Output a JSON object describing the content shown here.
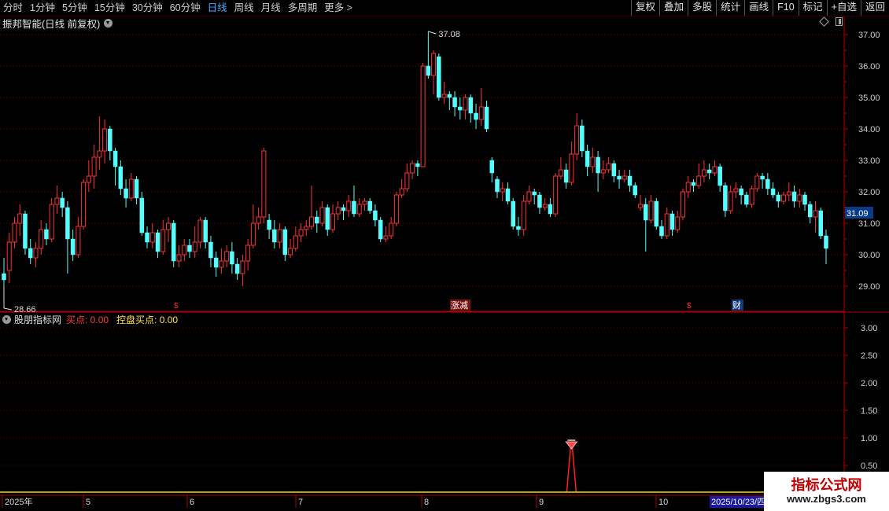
{
  "toolbar": {
    "periods": [
      "分时",
      "1分钟",
      "5分钟",
      "15分钟",
      "30分钟",
      "60分钟",
      "日线",
      "周线",
      "月线",
      "多周期",
      "更多 >"
    ],
    "active_period": "日线",
    "actions": [
      "复权",
      "叠加",
      "多股",
      "统计",
      "画线",
      "F10",
      "标记",
      "+自选",
      "返回"
    ]
  },
  "chart_title": "振邦智能(日线 前复权)",
  "indicator": {
    "name": "股朋指标网",
    "buy_label": "买点: 0.00",
    "control_label": "控盘买点: 0.00"
  },
  "price_axis": {
    "ticks": [
      "37.00",
      "36.00",
      "35.00",
      "34.00",
      "33.00",
      "32.00",
      "31.00",
      "30.00",
      "29.00"
    ]
  },
  "indicator_axis": {
    "ticks": [
      "3.00",
      "2.50",
      "2.00",
      "1.50",
      "1.00",
      "0.50"
    ]
  },
  "current_price": "31.09",
  "high_label": "37.08",
  "low_label": "28.66",
  "markers": {
    "limit_up": "涨减",
    "finance": "财",
    "dollar": "$"
  },
  "time_axis": {
    "labels": [
      "2025年",
      "5",
      "6",
      "7",
      "8",
      "9",
      "10"
    ],
    "selected_date": "2025/10/23/四"
  },
  "watermark": {
    "line1": "指标公式网",
    "line2": "www.zbgs3.com"
  },
  "colors": {
    "up": "#ff3232",
    "down": "#54ffff",
    "grid": "#6b0000",
    "axis": "#b00000",
    "indicator_line": "#ff2020",
    "baseline": "#e8e000"
  },
  "chart_data": {
    "type": "candlestick",
    "title": "振邦智能(日线 前复权)",
    "ylim": [
      28.6,
      37.3
    ],
    "indicator_ylim": [
      0,
      3.25
    ],
    "candles": [
      [
        29.4,
        29.2,
        29.9,
        29.0
      ],
      [
        29.5,
        30.4,
        30.7,
        29.1
      ],
      [
        30.4,
        31.0,
        31.2,
        30.2
      ],
      [
        31.0,
        31.3,
        31.6,
        30.6
      ],
      [
        31.3,
        30.2,
        31.4,
        30.0
      ],
      [
        30.2,
        29.9,
        30.5,
        29.7
      ],
      [
        29.9,
        30.2,
        30.4,
        29.6
      ],
      [
        30.2,
        30.8,
        31.1,
        30.0
      ],
      [
        30.8,
        30.5,
        31.0,
        30.3
      ],
      [
        30.5,
        31.6,
        31.8,
        30.4
      ],
      [
        31.6,
        31.8,
        32.2,
        31.3
      ],
      [
        31.8,
        31.5,
        32.0,
        31.2
      ],
      [
        31.5,
        30.5,
        31.7,
        29.4
      ],
      [
        30.5,
        30.0,
        30.8,
        29.8
      ],
      [
        30.0,
        30.9,
        31.2,
        29.9
      ],
      [
        30.9,
        32.3,
        32.4,
        30.8
      ],
      [
        32.3,
        32.5,
        33.0,
        32.0
      ],
      [
        32.5,
        33.1,
        33.5,
        32.1
      ],
      [
        33.1,
        33.3,
        34.4,
        32.7
      ],
      [
        33.3,
        34.0,
        34.3,
        32.9
      ],
      [
        34.0,
        33.3,
        34.1,
        33.0
      ],
      [
        33.3,
        32.8,
        33.4,
        32.2
      ],
      [
        32.8,
        32.1,
        33.0,
        31.9
      ],
      [
        32.1,
        31.8,
        32.4,
        31.5
      ],
      [
        31.8,
        32.4,
        32.6,
        31.7
      ],
      [
        32.4,
        31.8,
        32.5,
        31.6
      ],
      [
        31.8,
        30.7,
        32.0,
        30.6
      ],
      [
        30.7,
        30.4,
        30.9,
        30.2
      ],
      [
        30.4,
        30.7,
        31.0,
        30.2
      ],
      [
        30.7,
        30.1,
        30.8,
        29.9
      ],
      [
        30.1,
        30.8,
        31.1,
        30.0
      ],
      [
        30.8,
        31.0,
        31.2,
        30.4
      ],
      [
        31.0,
        29.8,
        31.1,
        29.6
      ],
      [
        29.8,
        30.0,
        30.3,
        29.6
      ],
      [
        30.0,
        30.3,
        30.5,
        29.8
      ],
      [
        30.3,
        30.1,
        30.5,
        29.9
      ],
      [
        30.1,
        30.4,
        30.9,
        29.9
      ],
      [
        30.4,
        31.1,
        31.2,
        30.2
      ],
      [
        31.1,
        30.4,
        31.2,
        30.2
      ],
      [
        30.4,
        29.9,
        30.6,
        29.6
      ],
      [
        29.9,
        29.6,
        30.1,
        29.3
      ],
      [
        29.6,
        29.8,
        30.2,
        29.4
      ],
      [
        29.8,
        30.1,
        30.3,
        29.6
      ],
      [
        30.1,
        29.7,
        30.4,
        29.4
      ],
      [
        29.7,
        29.4,
        29.9,
        29.2
      ],
      [
        29.4,
        29.8,
        30.0,
        29.0
      ],
      [
        29.8,
        30.3,
        30.5,
        29.5
      ],
      [
        30.3,
        31.0,
        31.6,
        30.2
      ],
      [
        31.0,
        31.2,
        31.5,
        30.8
      ],
      [
        31.2,
        33.3,
        33.4,
        31.0
      ],
      [
        31.1,
        30.8,
        31.3,
        30.5
      ],
      [
        30.8,
        30.4,
        31.1,
        30.2
      ],
      [
        30.4,
        30.8,
        31.0,
        30.2
      ],
      [
        30.8,
        30.0,
        30.9,
        29.8
      ],
      [
        30.0,
        30.2,
        30.5,
        29.9
      ],
      [
        30.2,
        30.6,
        30.9,
        30.1
      ],
      [
        30.6,
        30.8,
        31.0,
        30.4
      ],
      [
        30.8,
        30.9,
        31.1,
        30.6
      ],
      [
        30.9,
        31.2,
        32.2,
        30.8
      ],
      [
        31.2,
        31.0,
        31.4,
        30.7
      ],
      [
        31.0,
        31.5,
        31.7,
        30.9
      ],
      [
        31.5,
        30.8,
        31.6,
        30.6
      ],
      [
        30.8,
        31.3,
        31.6,
        30.7
      ],
      [
        31.3,
        31.5,
        31.7,
        31.1
      ],
      [
        31.5,
        31.4,
        31.6,
        31.1
      ],
      [
        31.4,
        31.7,
        31.9,
        31.2
      ],
      [
        31.7,
        31.3,
        32.2,
        31.2
      ],
      [
        31.3,
        31.6,
        31.8,
        31.2
      ],
      [
        31.6,
        31.7,
        31.8,
        31.4
      ],
      [
        31.7,
        31.4,
        31.8,
        31.3
      ],
      [
        31.4,
        31.1,
        31.6,
        30.9
      ],
      [
        31.1,
        30.5,
        31.2,
        30.4
      ],
      [
        30.5,
        30.6,
        30.9,
        30.4
      ],
      [
        30.6,
        31.0,
        31.2,
        30.5
      ],
      [
        31.0,
        31.9,
        32.0,
        30.9
      ],
      [
        31.9,
        32.1,
        32.4,
        31.8
      ],
      [
        32.1,
        32.6,
        32.9,
        32.0
      ],
      [
        32.6,
        32.9,
        33.0,
        32.4
      ],
      [
        32.9,
        32.8,
        33.0,
        32.5
      ],
      [
        32.8,
        36.0,
        36.1,
        32.8
      ],
      [
        36.0,
        35.7,
        37.1,
        35.6
      ],
      [
        35.7,
        36.4,
        36.5,
        35.1
      ],
      [
        36.3,
        35.0,
        36.4,
        34.9
      ],
      [
        35.0,
        35.1,
        35.5,
        34.8
      ],
      [
        35.1,
        35.0,
        35.2,
        34.6
      ],
      [
        35.0,
        34.7,
        35.2,
        34.4
      ],
      [
        34.7,
        34.6,
        35.0,
        34.3
      ],
      [
        34.6,
        35.0,
        35.1,
        34.3
      ],
      [
        35.0,
        34.5,
        35.1,
        34.2
      ],
      [
        34.5,
        34.3,
        34.8,
        34.0
      ],
      [
        34.3,
        34.7,
        35.3,
        34.1
      ],
      [
        34.7,
        34.0,
        34.9,
        33.9
      ],
      [
        33.0,
        32.6,
        33.1,
        32.3
      ],
      [
        32.4,
        32.0,
        32.5,
        31.8
      ],
      [
        32.0,
        32.1,
        32.3,
        31.7
      ],
      [
        32.1,
        31.7,
        32.3,
        31.6
      ],
      [
        31.7,
        30.9,
        31.8,
        30.8
      ],
      [
        30.9,
        30.8,
        31.2,
        30.6
      ],
      [
        30.8,
        31.7,
        31.9,
        30.6
      ],
      [
        31.7,
        32.0,
        32.2,
        31.6
      ],
      [
        32.0,
        31.9,
        32.1,
        31.6
      ],
      [
        31.9,
        31.5,
        32.0,
        31.3
      ],
      [
        31.5,
        31.6,
        31.8,
        31.4
      ],
      [
        31.6,
        31.3,
        31.8,
        31.2
      ],
      [
        31.3,
        32.5,
        32.6,
        31.2
      ],
      [
        32.5,
        32.7,
        33.1,
        32.4
      ],
      [
        32.7,
        32.3,
        32.9,
        32.1
      ],
      [
        32.3,
        33.2,
        33.6,
        32.2
      ],
      [
        33.2,
        34.1,
        34.5,
        33.0
      ],
      [
        34.1,
        33.3,
        34.3,
        33.1
      ],
      [
        33.3,
        32.8,
        33.5,
        32.5
      ],
      [
        32.8,
        33.1,
        33.4,
        32.6
      ],
      [
        33.1,
        32.6,
        33.3,
        32.0
      ],
      [
        32.6,
        32.7,
        33.0,
        32.4
      ],
      [
        32.7,
        32.9,
        33.1,
        32.6
      ],
      [
        32.9,
        32.5,
        33.0,
        32.3
      ],
      [
        32.5,
        32.4,
        32.7,
        32.1
      ],
      [
        32.4,
        32.5,
        32.7,
        32.3
      ],
      [
        32.5,
        32.2,
        32.7,
        32.0
      ],
      [
        32.2,
        31.9,
        32.3,
        31.8
      ],
      [
        31.5,
        31.6,
        31.9,
        31.4
      ],
      [
        31.6,
        31.1,
        31.8,
        30.1
      ],
      [
        31.1,
        31.7,
        31.9,
        31.0
      ],
      [
        31.7,
        30.9,
        31.8,
        30.8
      ],
      [
        30.9,
        30.6,
        31.1,
        30.5
      ],
      [
        30.6,
        31.3,
        31.5,
        30.5
      ],
      [
        31.3,
        30.8,
        31.4,
        30.6
      ],
      [
        30.8,
        31.2,
        31.4,
        30.7
      ],
      [
        31.2,
        32.0,
        32.1,
        31.1
      ],
      [
        32.0,
        32.3,
        32.5,
        31.8
      ],
      [
        32.3,
        32.2,
        32.4,
        32.0
      ],
      [
        32.2,
        32.5,
        32.9,
        32.1
      ],
      [
        32.5,
        32.7,
        33.0,
        32.3
      ],
      [
        32.7,
        32.6,
        32.9,
        32.4
      ],
      [
        32.6,
        32.8,
        33.0,
        32.5
      ],
      [
        32.8,
        32.2,
        32.9,
        32.0
      ],
      [
        32.2,
        31.4,
        32.3,
        31.2
      ],
      [
        31.4,
        32.0,
        32.2,
        31.3
      ],
      [
        32.0,
        32.1,
        32.3,
        31.8
      ],
      [
        32.1,
        31.9,
        32.2,
        31.6
      ],
      [
        31.9,
        31.6,
        32.0,
        31.5
      ],
      [
        31.6,
        32.1,
        32.2,
        31.5
      ],
      [
        32.1,
        32.5,
        32.6,
        32.0
      ],
      [
        32.5,
        32.4,
        32.6,
        32.1
      ],
      [
        32.4,
        32.1,
        32.6,
        31.9
      ],
      [
        32.1,
        31.9,
        32.3,
        31.8
      ],
      [
        31.9,
        31.7,
        32.0,
        31.5
      ],
      [
        31.7,
        31.9,
        32.0,
        31.6
      ],
      [
        31.9,
        32.0,
        32.3,
        31.7
      ],
      [
        32.0,
        31.7,
        32.2,
        31.5
      ],
      [
        31.7,
        31.9,
        32.1,
        31.5
      ],
      [
        31.9,
        31.6,
        32.0,
        31.4
      ],
      [
        31.6,
        31.2,
        31.7,
        31.0
      ],
      [
        31.2,
        31.4,
        31.7,
        30.7
      ],
      [
        31.4,
        30.6,
        31.5,
        30.5
      ],
      [
        30.6,
        30.2,
        30.8,
        29.7
      ]
    ],
    "indicator_series": [
      {
        "name": "买点",
        "values": {
          "spike_index": 107,
          "spike_value": 0.9
        }
      }
    ]
  }
}
